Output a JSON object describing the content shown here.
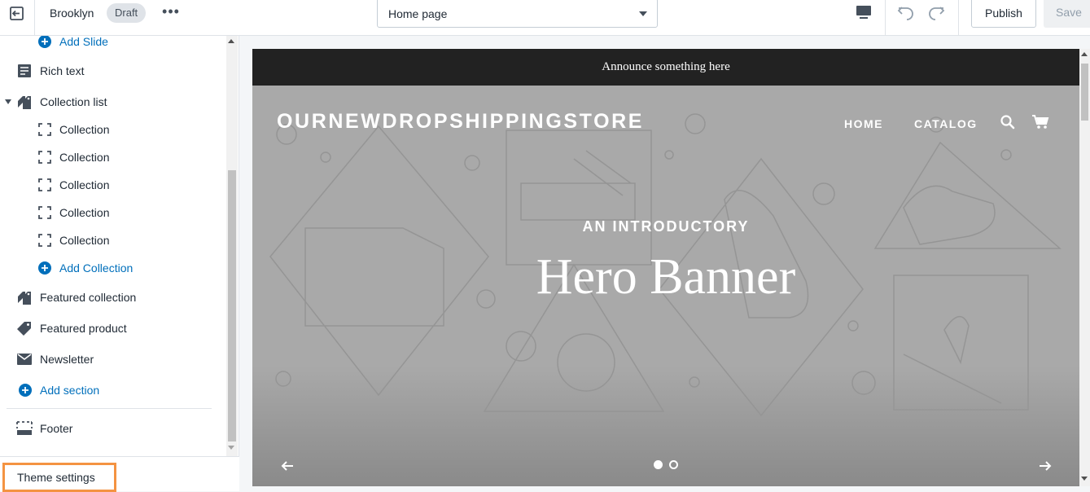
{
  "topbar": {
    "theme_name": "Brooklyn",
    "status_badge": "Draft",
    "more_label": "•••",
    "page_selector": "Home page",
    "publish_label": "Publish",
    "save_label": "Save"
  },
  "sidebar": {
    "items": [
      {
        "label": "Add Slide"
      },
      {
        "label": "Rich text"
      },
      {
        "label": "Collection list"
      },
      {
        "label": "Collection"
      },
      {
        "label": "Collection"
      },
      {
        "label": "Collection"
      },
      {
        "label": "Collection"
      },
      {
        "label": "Collection"
      },
      {
        "label": "Add Collection"
      },
      {
        "label": "Featured collection"
      },
      {
        "label": "Featured product"
      },
      {
        "label": "Newsletter"
      },
      {
        "label": "Add section"
      },
      {
        "label": "Footer"
      }
    ],
    "theme_settings": "Theme settings"
  },
  "preview": {
    "announcement": "Announce something here",
    "store_name": "OURNEWDROPSHIPPINGSTORE",
    "nav": [
      "HOME",
      "CATALOG"
    ],
    "hero_subtitle": "AN INTRODUCTORY",
    "hero_title": "Hero Banner",
    "slides": 2,
    "active_slide": 1
  },
  "colors": {
    "accent": "#006fbb",
    "highlight": "#f49342",
    "announce_bg": "#222222",
    "hero_bg": "#a9a9a9"
  }
}
